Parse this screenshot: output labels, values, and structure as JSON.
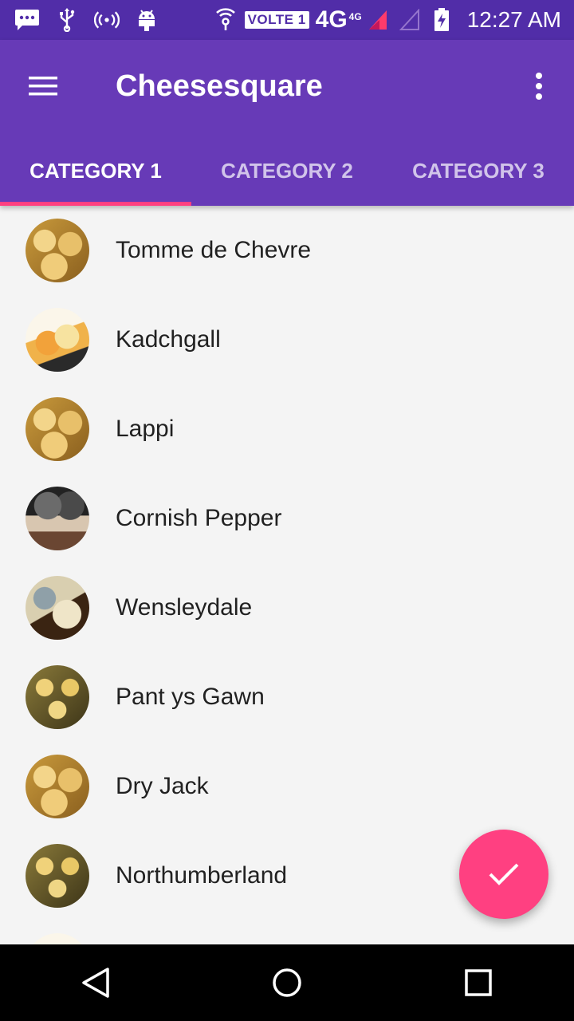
{
  "status_bar": {
    "volte_label": "VOLTE 1",
    "network_label": "4G",
    "network_sup": "4G",
    "time": "12:27 AM",
    "icons": [
      "message-icon",
      "usb-icon",
      "hotspot-icon",
      "android-debug-icon",
      "wifi-calling-icon",
      "signal-icon",
      "signal-empty-icon",
      "battery-charging-icon"
    ]
  },
  "app_bar": {
    "title": "Cheesesquare",
    "color": "#673ab7",
    "status_color": "#512da8"
  },
  "tabs": [
    {
      "label": "CATEGORY 1",
      "active": true
    },
    {
      "label": "CATEGORY 2",
      "active": false
    },
    {
      "label": "CATEGORY 3",
      "active": false
    }
  ],
  "accent_color": "#ff4081",
  "list": {
    "items": [
      {
        "label": "Tomme de Chevre",
        "avatar": "cheese-cubes"
      },
      {
        "label": "Kadchgall",
        "avatar": "cheese-wedges"
      },
      {
        "label": "Lappi",
        "avatar": "cheese-cubes"
      },
      {
        "label": "Cornish Pepper",
        "avatar": "cheese-dark"
      },
      {
        "label": "Wensleydale",
        "avatar": "cheese-blue"
      },
      {
        "label": "Pant ys Gawn",
        "avatar": "cheese-rounds"
      },
      {
        "label": "Dry Jack",
        "avatar": "cheese-cubes"
      },
      {
        "label": "Northumberland",
        "avatar": "cheese-rounds"
      },
      {
        "label": "",
        "avatar": "cheese-wedges"
      }
    ]
  },
  "fab": {
    "icon": "check-icon"
  },
  "nav_bar": {
    "icons": [
      "back-icon",
      "home-icon",
      "recents-icon"
    ]
  }
}
